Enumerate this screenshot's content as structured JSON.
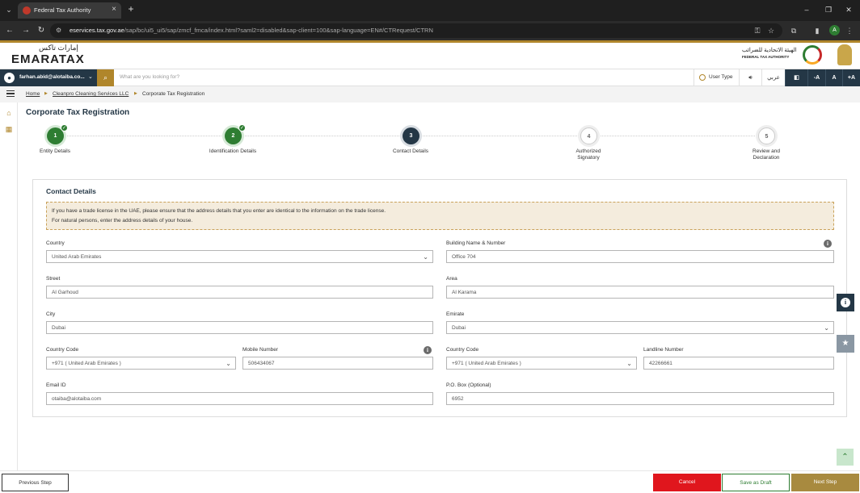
{
  "browser": {
    "tab_title": "Federal Tax Authority",
    "url_host": "eservices.tax.gov.ae",
    "url_path": "/sap/bc/ui5_ui5/sap/zmcf_fmca/index.html?saml2=disabled&sap-client=100&sap-language=EN#/CTRequest/CTRN",
    "profile_initial": "A"
  },
  "header": {
    "logo_arabic": "إمارات تاكس",
    "logo_english": "EMARATAX",
    "authority_arabic": "الهيئة الاتحادية للضرائب",
    "authority_english": "FEDERAL TAX AUTHORITY"
  },
  "toolbar": {
    "user_email": "farhan.abid@alotaiba.co...",
    "search_placeholder": "What are you looking for?",
    "user_type_label": "User Type",
    "arabic_label": "عربي",
    "font_decrease": "-A",
    "font_normal": "A",
    "font_increase": "+A"
  },
  "breadcrumb": {
    "home": "Home",
    "company": "Cleanpro Cleaning Services LLC",
    "current": "Corporate Tax Registration"
  },
  "page": {
    "title": "Corporate Tax Registration"
  },
  "steps": [
    {
      "number": "1",
      "label": "Entity Details",
      "state": "done"
    },
    {
      "number": "2",
      "label": "Identification Details",
      "state": "done"
    },
    {
      "number": "3",
      "label": "Contact Details",
      "state": "active"
    },
    {
      "number": "4",
      "label_line1": "Authorized",
      "label_line2": "Signatory",
      "state": "todo"
    },
    {
      "number": "5",
      "label_line1": "Review and",
      "label_line2": "Declaration",
      "state": "todo"
    }
  ],
  "contact": {
    "title": "Contact Details",
    "notice_line1": "If you have a trade license in the UAE, please ensure that the address details that you enter are identical to the information on the trade license.",
    "notice_line2": "For natural persons, enter the address details of your house.",
    "country_label": "Country",
    "country_value": "United Arab Emirates",
    "building_label": "Building Name & Number",
    "building_value": "Office 704",
    "street_label": "Street",
    "street_value": "Al Garhoud",
    "area_label": "Area",
    "area_value": "Al Karama",
    "city_label": "City",
    "city_value": "Dubai",
    "emirate_label": "Emirate",
    "emirate_value": "Dubai",
    "mobile_cc_label": "Country Code",
    "mobile_cc_value": "+971 ( United Arab Emirates )",
    "mobile_label": "Mobile Number",
    "mobile_value": "506434067",
    "landline_cc_label": "Country Code",
    "landline_cc_value": "+971 ( United Arab Emirates )",
    "landline_label": "Landline Number",
    "landline_value": "42266661",
    "email_label": "Email ID",
    "email_value": "otaiba@alotaiba.com",
    "pobox_label": "P.O. Box (Optional)",
    "pobox_value": "6952"
  },
  "footer": {
    "previous": "Previous Step",
    "cancel": "Cancel",
    "save_draft": "Save as Draft",
    "next": "Next Step"
  },
  "colors": {
    "brand_gold": "#b0862b",
    "navy": "#243746",
    "success_green": "#2e7d32",
    "cancel_red": "#e0161d"
  }
}
